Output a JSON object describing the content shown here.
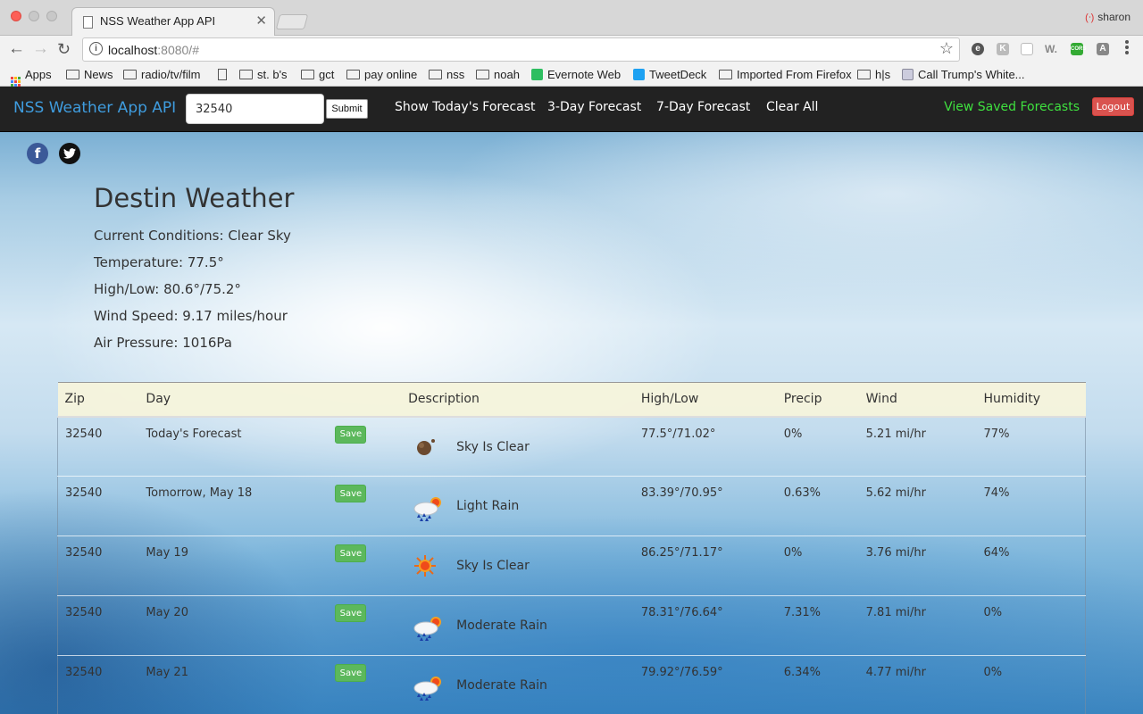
{
  "browser": {
    "tab_title": "NSS Weather App API",
    "profile_name": "sharon",
    "url_host": "localhost",
    "url_rest": ":8080/#",
    "bookmarks": [
      {
        "label": "Apps",
        "icon": "apps-grid-icon"
      },
      {
        "label": "News",
        "icon": "folder-icon"
      },
      {
        "label": "radio/tv/film",
        "icon": "folder-icon"
      },
      {
        "label": "",
        "icon": "page-icon"
      },
      {
        "label": "st. b's",
        "icon": "folder-icon"
      },
      {
        "label": "gct",
        "icon": "folder-icon"
      },
      {
        "label": "pay online",
        "icon": "folder-icon"
      },
      {
        "label": "nss",
        "icon": "folder-icon"
      },
      {
        "label": "noah",
        "icon": "folder-icon"
      },
      {
        "label": "Evernote Web",
        "icon": "evernote-icon"
      },
      {
        "label": "TweetDeck",
        "icon": "tweetdeck-icon"
      },
      {
        "label": "Imported From Firefox",
        "icon": "folder-icon"
      },
      {
        "label": "h|s",
        "icon": "folder-icon"
      },
      {
        "label": "Call Trump's White...",
        "icon": "page-icon"
      }
    ]
  },
  "navbar": {
    "brand": "NSS Weather App API",
    "zip_value": "32540",
    "submit_label": "Submit",
    "links": [
      "Show Today's Forecast",
      "3-Day Forecast",
      "7-Day Forecast",
      "Clear All"
    ],
    "saved_label": "View Saved Forecasts",
    "logout_label": "Logout"
  },
  "current": {
    "city": "Destin Weather",
    "conditions": "Current Conditions: Clear Sky",
    "temperature": "Temperature: 77.5°",
    "high_low": "High/Low: 80.6°/75.2°",
    "wind": "Wind Speed: 9.17 miles/hour",
    "pressure": "Air Pressure: 1016Pa"
  },
  "table": {
    "headers": [
      "Zip",
      "Day",
      "Description",
      "High/Low",
      "Precip",
      "Wind",
      "Humidity"
    ],
    "save_label": "Save",
    "rows": [
      {
        "zip": "32540",
        "day": "Today's Forecast",
        "icon": "night-clear-icon",
        "description": "Sky Is Clear",
        "high_low": "77.5°/71.02°",
        "precip": "0%",
        "wind": "5.21 mi/hr",
        "humidity": "77%"
      },
      {
        "zip": "32540",
        "day": "Tomorrow, May 18",
        "icon": "rain-sun-icon",
        "description": "Light Rain",
        "high_low": "83.39°/70.95°",
        "precip": "0.63%",
        "wind": "5.62 mi/hr",
        "humidity": "74%"
      },
      {
        "zip": "32540",
        "day": "May 19",
        "icon": "sun-icon",
        "description": "Sky Is Clear",
        "high_low": "86.25°/71.17°",
        "precip": "0%",
        "wind": "3.76 mi/hr",
        "humidity": "64%"
      },
      {
        "zip": "32540",
        "day": "May 20",
        "icon": "rain-sun-icon",
        "description": "Moderate Rain",
        "high_low": "78.31°/76.64°",
        "precip": "7.31%",
        "wind": "7.81 mi/hr",
        "humidity": "0%"
      },
      {
        "zip": "32540",
        "day": "May 21",
        "icon": "rain-sun-icon",
        "description": "Moderate Rain",
        "high_low": "79.92°/76.59°",
        "precip": "6.34%",
        "wind": "4.77 mi/hr",
        "humidity": "0%"
      }
    ]
  },
  "colors": {
    "navbar_bg": "#222222",
    "brand": "#3f9cde",
    "saved_link": "#3fe03f",
    "logout": "#d9534f",
    "save_button": "#5cb85c",
    "table_header": "#f5f4dc"
  }
}
